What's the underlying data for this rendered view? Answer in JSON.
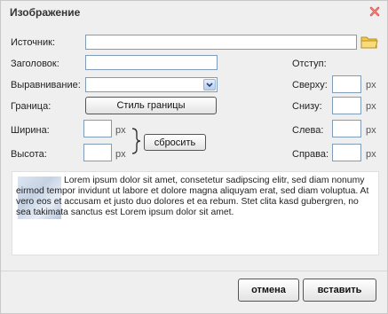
{
  "dialog": {
    "title": "Изображение"
  },
  "fields": {
    "source_label": "Источник:",
    "source_value": "",
    "title_label": "Заголовок:",
    "title_value": "",
    "align_label": "Выравнивание:",
    "align_value": "",
    "border_label": "Граница:",
    "border_button": "Стиль границы",
    "width_label": "Ширина:",
    "width_value": "",
    "height_label": "Высота:",
    "height_value": "",
    "unit": "px",
    "reset_button": "сбросить"
  },
  "margins": {
    "label": "Отступ:",
    "top_label": "Сверху:",
    "bottom_label": "Снизу:",
    "left_label": "Слева:",
    "right_label": "Справа:",
    "unit": "px"
  },
  "preview": {
    "text": "Lorem ipsum dolor sit amet, consetetur sadipscing elitr, sed diam nonumy eirmod tempor invidunt ut labore et dolore magna aliquyam erat, sed diam voluptua. At vero eos et accusam et justo duo dolores et ea rebum. Stet clita kasd gubergren, no sea takimata sanctus est Lorem ipsum dolor sit amet."
  },
  "footer": {
    "cancel_button": "отмена",
    "insert_button": "вставить"
  },
  "icons": {
    "close": "close-icon",
    "browse": "folder-icon",
    "dropdown": "chevron-down-icon",
    "brace": "brace-icon"
  },
  "colors": {
    "close_red": "#d9534f",
    "folder_yellow": "#f2c94c",
    "input_border": "#7f9db9"
  }
}
